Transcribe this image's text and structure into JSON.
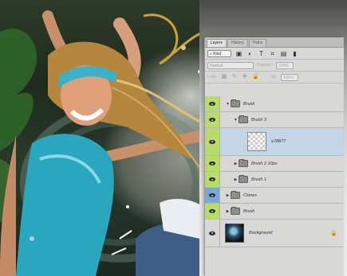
{
  "panel": {
    "tabs": [
      {
        "label": "Layers"
      },
      {
        "label": "History"
      },
      {
        "label": "Paths"
      }
    ],
    "filter": {
      "kind_label": "Kind"
    },
    "blend_mode": "Normal",
    "opacity_label": "Opacity:",
    "opacity_value": "100%",
    "lock_label": "Lock:",
    "fill_label": "Fill:",
    "fill_value": "100%"
  },
  "layers": [
    {
      "name": "Brush",
      "type": "group",
      "indent": 0,
      "expanded": true,
      "eye": "green"
    },
    {
      "name": "Brush 3",
      "type": "group",
      "indent": 1,
      "expanded": true,
      "eye": "green"
    },
    {
      "name": "e78877",
      "type": "layer",
      "indent": 2,
      "selected": true,
      "eye": "green"
    },
    {
      "name": "Brush 2 10px",
      "type": "group",
      "indent": 1,
      "expanded": false,
      "eye": "green"
    },
    {
      "name": "Brush 1",
      "type": "group",
      "indent": 1,
      "expanded": false,
      "eye": "green"
    },
    {
      "name": "Clones",
      "type": "group",
      "indent": 0,
      "expanded": false,
      "eye": "blue"
    },
    {
      "name": "Brush",
      "type": "group",
      "indent": 0,
      "expanded": false,
      "eye": "green"
    },
    {
      "name": "Background",
      "type": "background",
      "indent": 0,
      "locked": true,
      "eye": "plain"
    }
  ],
  "colors": {
    "accent_green": "#b8dc6a",
    "accent_blue": "#7aa7d6",
    "selection": "#c4d5e6"
  }
}
